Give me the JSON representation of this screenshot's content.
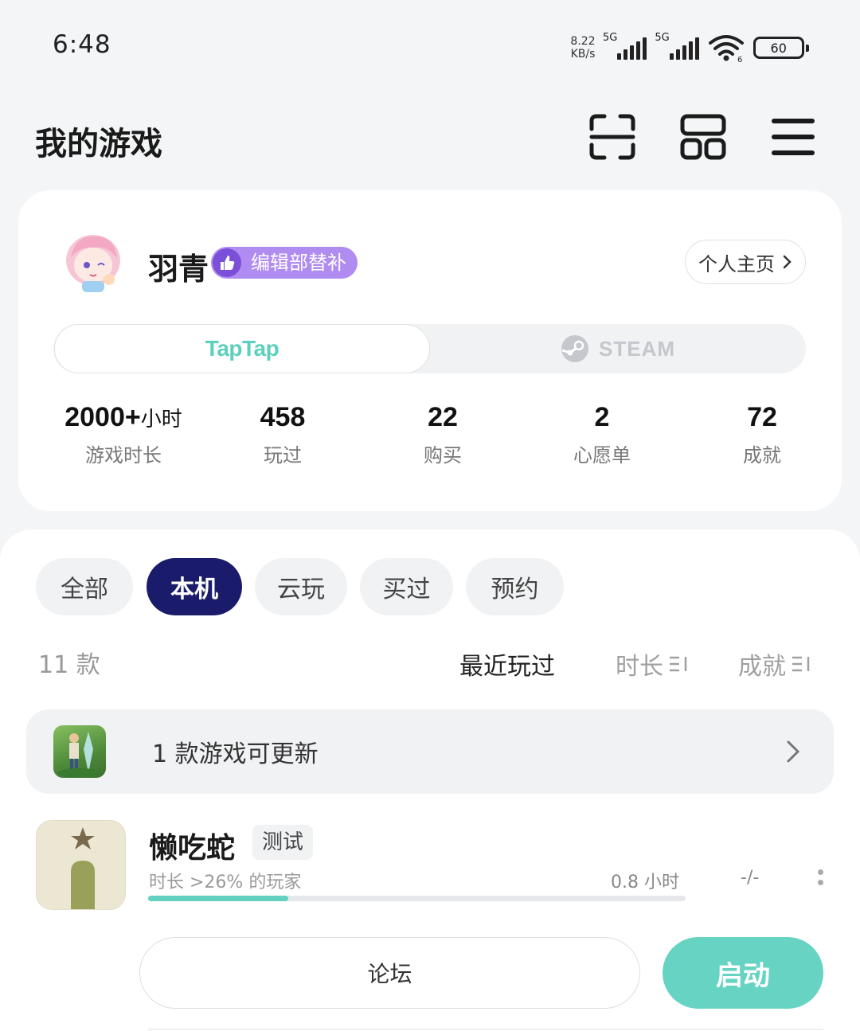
{
  "status_bar": {
    "time": "6:48",
    "net_speed_value": "8.22",
    "net_speed_unit": "KB/s",
    "signal1_label": "5G",
    "signal2_label": "5G",
    "wifi_label": "6",
    "battery": "60"
  },
  "header": {
    "title": "我的游戏",
    "icons": [
      "scan-icon",
      "apps-grid-icon",
      "menu-icon"
    ]
  },
  "profile": {
    "username": "羽青",
    "badge": "编辑部替补",
    "homepage_label": "个人主页"
  },
  "platforms": {
    "taptap": "TapTap",
    "steam": "STEAM",
    "selected": "TapTap"
  },
  "stats": [
    {
      "value": "2000+",
      "unit": "小时",
      "label": "游戏时长"
    },
    {
      "value": "458",
      "unit": "",
      "label": "玩过"
    },
    {
      "value": "22",
      "unit": "",
      "label": "购买"
    },
    {
      "value": "2",
      "unit": "",
      "label": "心愿单"
    },
    {
      "value": "72",
      "unit": "",
      "label": "成就"
    }
  ],
  "filters": {
    "items": [
      "全部",
      "本机",
      "云玩",
      "买过",
      "预约"
    ],
    "active": "本机"
  },
  "list_meta": {
    "count": "11 款",
    "sort_recent": "最近玩过",
    "sort_duration": "时长",
    "sort_achievement": "成就"
  },
  "update_banner": {
    "text": "1 款游戏可更新"
  },
  "game": {
    "title": "懒吃蛇",
    "tag": "测试",
    "subtitle": "时长 >26% 的玩家",
    "hours": "0.8 小时",
    "achievements": "-/-",
    "progress": 0.26,
    "forum_label": "论坛",
    "launch_label": "启动"
  },
  "colors": {
    "accent_teal": "#67d3c2",
    "filter_active": "#1b1b6b",
    "badge_purple": "#b08cf0",
    "taptap_brand": "#5dcfbe"
  }
}
